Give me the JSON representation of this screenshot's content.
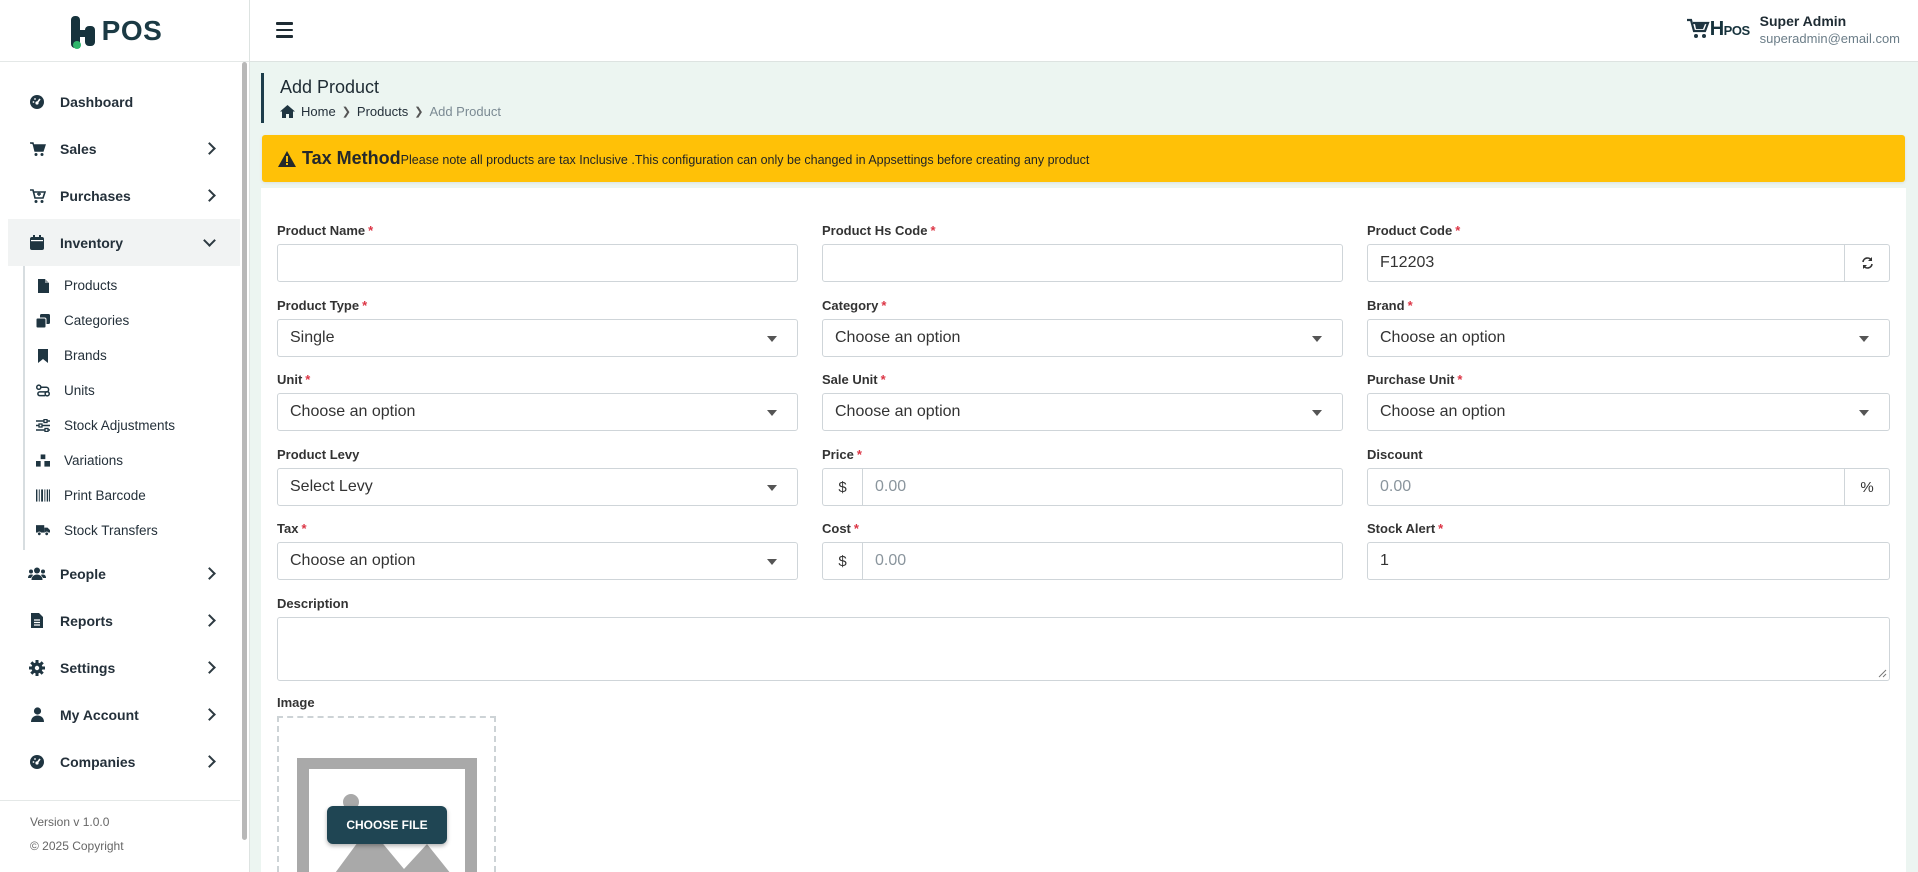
{
  "brand": {
    "logo_text": "POS"
  },
  "sidebar": {
    "items": [
      {
        "label": "Dashboard"
      },
      {
        "label": "Sales"
      },
      {
        "label": "Purchases"
      },
      {
        "label": "Inventory"
      },
      {
        "label": "People"
      },
      {
        "label": "Reports"
      },
      {
        "label": "Settings"
      },
      {
        "label": "My Account"
      },
      {
        "label": "Companies"
      }
    ],
    "inventory_sub": [
      {
        "label": "Products"
      },
      {
        "label": "Categories"
      },
      {
        "label": "Brands"
      },
      {
        "label": "Units"
      },
      {
        "label": "Stock Adjustments"
      },
      {
        "label": "Variations"
      },
      {
        "label": "Print Barcode"
      },
      {
        "label": "Stock Transfers"
      }
    ],
    "version": "Version v 1.0.0",
    "copyright": "© 2025 Copyright"
  },
  "topbar": {
    "user_logo_prefix": "H",
    "user_logo_suffix": "POS",
    "user_name": "Super Admin",
    "user_email": "superadmin@email.com"
  },
  "page": {
    "title": "Add Product",
    "breadcrumb": [
      "Home",
      "Products",
      "Add Product"
    ]
  },
  "alert": {
    "title": "Tax Method",
    "text": "Please note all products are tax Inclusive .This configuration can only be changed in Appsettings before creating any product"
  },
  "form": {
    "product_name": {
      "label": "Product Name",
      "value": ""
    },
    "hs_code": {
      "label": "Product Hs Code",
      "value": ""
    },
    "product_code": {
      "label": "Product Code",
      "value": "F12203"
    },
    "product_type": {
      "label": "Product Type",
      "value": "Single"
    },
    "category": {
      "label": "Category",
      "value": "Choose an option"
    },
    "brand": {
      "label": "Brand",
      "value": "Choose an option"
    },
    "unit": {
      "label": "Unit",
      "value": "Choose an option"
    },
    "sale_unit": {
      "label": "Sale Unit",
      "value": "Choose an option"
    },
    "purchase_unit": {
      "label": "Purchase Unit",
      "value": "Choose an option"
    },
    "levy": {
      "label": "Product Levy",
      "value": "Select Levy"
    },
    "price": {
      "label": "Price",
      "prefix": "$",
      "placeholder": "0.00"
    },
    "discount": {
      "label": "Discount",
      "placeholder": "0.00",
      "suffix": "%"
    },
    "tax": {
      "label": "Tax",
      "value": "Choose an option"
    },
    "cost": {
      "label": "Cost",
      "prefix": "$",
      "placeholder": "0.00"
    },
    "stock_alert": {
      "label": "Stock Alert",
      "value": "1"
    },
    "description": {
      "label": "Description"
    },
    "image": {
      "label": "Image",
      "button": "CHOOSE FILE"
    },
    "required_mark": "*"
  },
  "colors": {
    "primary": "#1d3d4b",
    "alert": "#ffc107",
    "required": "#dc3545"
  }
}
